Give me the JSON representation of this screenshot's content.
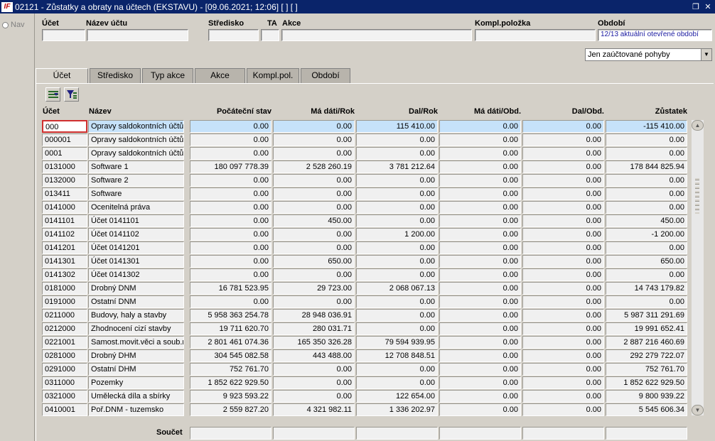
{
  "window": {
    "title": "02121 - Zůstatky a obraty na účtech (EKSTAVU) - [09.06.2021; 12:06]  [ ]  [ ]",
    "icon": "app-logo-icon"
  },
  "nav": {
    "label": "Nav"
  },
  "filters": {
    "ucet_label": "Účet",
    "ucet_value": "",
    "nazev_label": "Název účtu",
    "nazev_value": "",
    "stredisko_label": "Středisko",
    "stredisko_value": "",
    "ta_label": "TA",
    "ta_value": "",
    "akce_label": "Akce",
    "akce_value": "",
    "kompl_label": "Kompl.položka",
    "kompl_value": "",
    "obdobi_label": "Období",
    "obdobi_value": "12/13 aktuální otevřené období"
  },
  "dropdown": {
    "selected": "Jen zaúčtované pohyby"
  },
  "tabs": [
    "Účet",
    "Středisko",
    "Typ akce",
    "Akce",
    "Kompl.pol.",
    "Období"
  ],
  "toolbar": {
    "icons": [
      "filter-list-icon",
      "filter-funnel-icon"
    ]
  },
  "columns": [
    "Účet",
    "Název",
    "Počáteční stav",
    "Má dáti/Rok",
    "Dal/Rok",
    "Má dáti/Obd.",
    "Dal/Obd.",
    "Zůstatek"
  ],
  "rows": [
    [
      "000",
      "Opravy saldokontních účtů",
      "0.00",
      "0.00",
      "115 410.00",
      "0.00",
      "0.00",
      "-115 410.00"
    ],
    [
      "000001",
      "Opravy saldokontních účtů",
      "0.00",
      "0.00",
      "0.00",
      "0.00",
      "0.00",
      "0.00"
    ],
    [
      "0001",
      "Opravy saldokontních účtů",
      "0.00",
      "0.00",
      "0.00",
      "0.00",
      "0.00",
      "0.00"
    ],
    [
      "0131000",
      "Software 1",
      "180 097 778.39",
      "2 528 260.19",
      "3 781 212.64",
      "0.00",
      "0.00",
      "178 844 825.94"
    ],
    [
      "0132000",
      "Software 2",
      "0.00",
      "0.00",
      "0.00",
      "0.00",
      "0.00",
      "0.00"
    ],
    [
      "013411",
      "Software",
      "0.00",
      "0.00",
      "0.00",
      "0.00",
      "0.00",
      "0.00"
    ],
    [
      "0141000",
      "Ocenitelná práva",
      "0.00",
      "0.00",
      "0.00",
      "0.00",
      "0.00",
      "0.00"
    ],
    [
      "0141101",
      "Účet 0141101",
      "0.00",
      "450.00",
      "0.00",
      "0.00",
      "0.00",
      "450.00"
    ],
    [
      "0141102",
      "Účet 0141102",
      "0.00",
      "0.00",
      "1 200.00",
      "0.00",
      "0.00",
      "-1 200.00"
    ],
    [
      "0141201",
      "Účet 0141201",
      "0.00",
      "0.00",
      "0.00",
      "0.00",
      "0.00",
      "0.00"
    ],
    [
      "0141301",
      "Účet 0141301",
      "0.00",
      "650.00",
      "0.00",
      "0.00",
      "0.00",
      "650.00"
    ],
    [
      "0141302",
      "Účet 0141302",
      "0.00",
      "0.00",
      "0.00",
      "0.00",
      "0.00",
      "0.00"
    ],
    [
      "0181000",
      "Drobný DNM",
      "16 781 523.95",
      "29 723.00",
      "2 068 067.13",
      "0.00",
      "0.00",
      "14 743 179.82"
    ],
    [
      "0191000",
      "Ostatní DNM",
      "0.00",
      "0.00",
      "0.00",
      "0.00",
      "0.00",
      "0.00"
    ],
    [
      "0211000",
      "Budovy, haly a stavby",
      "5 958 363 254.78",
      "28 948 036.91",
      "0.00",
      "0.00",
      "0.00",
      "5 987 311 291.69"
    ],
    [
      "0212000",
      "Zhodnocení cizí stavby",
      "19 711 620.70",
      "280 031.71",
      "0.00",
      "0.00",
      "0.00",
      "19 991 652.41"
    ],
    [
      "0221001",
      "Samost.movit.věci a soub.m",
      "2 801 461 074.36",
      "165 350 326.28",
      "79 594 939.95",
      "0.00",
      "0.00",
      "2 887 216 460.69"
    ],
    [
      "0281000",
      "Drobný DHM",
      "304 545 082.58",
      "443 488.00",
      "12 708 848.51",
      "0.00",
      "0.00",
      "292 279 722.07"
    ],
    [
      "0291000",
      "Ostatní DHM",
      "752 761.70",
      "0.00",
      "0.00",
      "0.00",
      "0.00",
      "752 761.70"
    ],
    [
      "0311000",
      "Pozemky",
      "1 852 622 929.50",
      "0.00",
      "0.00",
      "0.00",
      "0.00",
      "1 852 622 929.50"
    ],
    [
      "0321000",
      "Umělecká díla a sbírky",
      "9 923 593.22",
      "0.00",
      "122 654.00",
      "0.00",
      "0.00",
      "9 800 939.22"
    ],
    [
      "0410001",
      "Poř.DNM - tuzemsko",
      "2 559 827.20",
      "4 321 982.11",
      "1 336 202.97",
      "0.00",
      "0.00",
      "5 545 606.34"
    ]
  ],
  "footer": {
    "soucet_label": "Součet"
  }
}
